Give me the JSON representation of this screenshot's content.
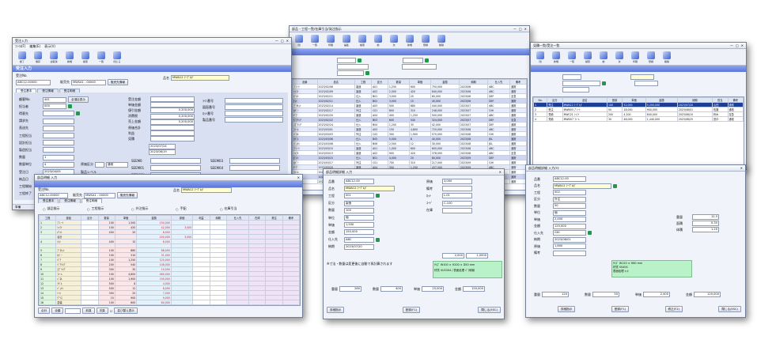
{
  "colors": {
    "header_band": "#6b85e0",
    "purple_table": "#6c6fc7",
    "selected_row": "#1d3f93",
    "input_yellow": "#ffffd2",
    "green_icon": "#1f9a4a"
  },
  "win1": {
    "title": "受注入力",
    "menu": [
      "ﾌｧｲﾙ(F)",
      "編集(E)",
      "表示(V)"
    ],
    "toolbar": [
      "終了",
      "保存",
      "全取消",
      "新規",
      "検索",
      "一覧",
      "閉じる"
    ],
    "band": "受注入力",
    "order_no_label": "受注No.",
    "order_no_value": "ABC12-00000",
    "dept_label": "販売先",
    "dept_value": "MWSA1 - 00000",
    "dept_btn": "販売先情報",
    "customer_label": "品名",
    "customer_value": "MWA12 ﾏｰｸﾞﾙｶﾞ",
    "tabs": [
      "受注基本",
      "受注情報",
      "受注明細"
    ],
    "left_labels": [
      "顧客No.",
      "担当者",
      "得意先",
      "請求先",
      "直送先",
      "工程担当",
      "設計担当",
      "製造担当",
      "数量",
      "数量単位",
      "受注日",
      "納品日",
      "工程開始",
      "工程終了"
    ],
    "left_values": [
      "441",
      "000",
      "",
      "",
      "",
      "",
      "",
      "",
      "1",
      "4",
      "2023/04/05",
      "2023/07/20",
      "2023/05/01",
      "2023/06/07"
    ],
    "left_extra": "全項目表示",
    "sub_selects": [
      "原価区分",
      "製品レベル",
      "通常"
    ],
    "mid_labels": [
      "受注金額",
      "単価金額",
      "値引金額",
      "消費税",
      "売上金額",
      "原価合計",
      "利益",
      "見積"
    ],
    "mid_values": [
      "",
      "",
      "5,200,000",
      "5,200,000",
      "5,200,000",
      "",
      "",
      ""
    ],
    "dates": [
      "2023/07/24",
      "2023/06/19"
    ],
    "codes": [
      "SEEM0",
      "SEEM01",
      "SEEM02",
      "SEEM03",
      "SEEM04"
    ],
    "right_labels": [
      "ﾗｲﾝ番号",
      "図面番号",
      "ﾛｯﾄ番号",
      "製品番号"
    ],
    "status": "準備"
  },
  "win2": {
    "title": "部品・工程一覧/在庫引当/発注指示",
    "toolbar": [
      "閉",
      "一覧",
      "印刷",
      "編集",
      "検索",
      "前",
      "次",
      "新規",
      "登録",
      "削除"
    ],
    "headers": [
      "品番",
      "品名",
      "工程",
      "区分",
      "数量",
      "単価",
      "金額",
      "納期",
      "仕入先",
      "備考"
    ],
    "rows": [
      [
        "ﾌﾟﾚｰﾄ",
        "2023/02/06",
        "製造",
        "A01",
        "1,250",
        "600",
        "750,000",
        "2023/06",
        "ABC",
        "通常"
      ],
      [
        "ｼｬﾌﾄ",
        "2023/02/09",
        "製造",
        "A02",
        "2,000",
        "420",
        "840,000",
        "2023/06",
        "ABC",
        "通常"
      ],
      [
        "ﾎﾞﾙﾄ",
        "2023/02/11",
        "仕入",
        "B01",
        "3,000",
        "20",
        "60,000",
        "2023/06",
        "DEF",
        "至急"
      ],
      [
        "ﾅｯﾄ",
        "2023/02/11",
        "仕入",
        "B02",
        "3,000",
        "15",
        "45,000",
        "2023/06",
        "DEF",
        "通常"
      ],
      [
        "ﾌﾞﾗｹｯﾄ",
        "2023/02/14",
        "製造",
        "A03",
        "500",
        "880",
        "440,000",
        "2023/07",
        "ABC",
        "通常"
      ],
      [
        "ｶﾊﾞｰ",
        "2023/02/17",
        "外注",
        "C01",
        "800",
        "310",
        "248,000",
        "2023/07",
        "GHI",
        "通常"
      ],
      [
        "ｷﾞｱ",
        "2023/02/20",
        "製造",
        "A04",
        "400",
        "1,250",
        "500,000",
        "2023/07",
        "ABC",
        "通常"
      ],
      [
        "ﾍﾞｱﾘﾝｸﾞ",
        "2023/02/22",
        "仕入",
        "B03",
        "600",
        "540",
        "324,000",
        "2023/07",
        "DEF",
        "至急"
      ],
      [
        "ｽﾌﾟﾘﾝｸﾞ",
        "2023/02/24",
        "仕入",
        "B04",
        "1,200",
        "35",
        "42,000",
        "2023/07",
        "DEF",
        "通常"
      ],
      [
        "ﾌﾚｰﾑ",
        "2023/03/01",
        "製造",
        "A05",
        "150",
        "4,800",
        "720,000",
        "2023/08",
        "ABC",
        "通常"
      ],
      [
        "ﾊﾟﾈﾙ",
        "2023/03/03",
        "外注",
        "C02",
        "300",
        "1,900",
        "570,000",
        "2023/08",
        "GHI",
        "通常"
      ],
      [
        "ﾗﾍﾞﾙ",
        "2023/03/06",
        "仕入",
        "B05",
        "5,000",
        "8",
        "40,000",
        "2023/08",
        "JKL",
        "通常"
      ],
      [
        "ﾊﾟｯｷﾝ",
        "2023/03/08",
        "仕入",
        "B06",
        "2,500",
        "12",
        "30,000",
        "2023/08",
        "JKL",
        "通常"
      ],
      [
        "ﾌﾟﾚｰﾄ",
        "2023/03/10",
        "製造",
        "A01",
        "1,000",
        "600",
        "600,000",
        "2023/08",
        "ABC",
        "通常"
      ],
      [
        "ｼｬﾌﾄ",
        "2023/03/13",
        "製造",
        "A02",
        "900",
        "420",
        "378,000",
        "2023/08",
        "ABC",
        "至急"
      ],
      [
        "ﾎﾞﾙﾄ",
        "2023/03/15",
        "仕入",
        "B01",
        "4,000",
        "20",
        "80,000",
        "2023/09",
        "DEF",
        "通常"
      ],
      [
        "ｶﾊﾞｰ",
        "2023/03/17",
        "外注",
        "C01",
        "700",
        "310",
        "217,000",
        "2023/09",
        "GHI",
        "通常"
      ],
      [
        "ｷﾞｱ",
        "2023/03/20",
        "製造",
        "A04",
        "350",
        "1,250",
        "437,500",
        "2023/09",
        "ABC",
        "通常"
      ],
      [
        "ﾌﾚｰﾑ",
        "2023/03/22",
        "製造",
        "A05",
        "120",
        "4,800",
        "576,000",
        "2023/09",
        "ABC",
        "通常"
      ],
      [
        "ﾊﾟﾈﾙ",
        "2023/03/24",
        "外注",
        "C02",
        "250",
        "1,900",
        "475,000",
        "2023/09",
        "GHI",
        "通常"
      ],
      [
        "ﾗﾍﾞﾙ",
        "2023/03/27",
        "仕入",
        "B05",
        "3,000",
        "8",
        "24,000",
        "2023/09",
        "JKL",
        "通常"
      ]
    ]
  },
  "win3": {
    "title": "見積一覧/受注一覧",
    "toolbar": [
      "閉",
      "新規",
      "一覧",
      "検索",
      "前",
      "次",
      "印刷",
      "登録",
      "削除"
    ],
    "band": "",
    "headers": [
      "No.",
      "区分",
      "品名",
      "数量",
      "単価",
      "金額",
      "納期",
      "担当",
      "備考"
    ],
    "rows": [
      [
        "1",
        "受注",
        "MWA12 ﾏｰｸﾞﾙｶﾞ",
        "100",
        "52,000",
        "5,200,000",
        "2023/07/20",
        "山田",
        "通常"
      ],
      [
        "2",
        "受注",
        "MWB03 ﾌﾟﾚｰﾄ",
        "50",
        "18,000",
        "900,000",
        "2023/08/01",
        "佐藤",
        "通常"
      ],
      [
        "3",
        "見積",
        "MWC21 ｼｬﾌﾄ",
        "200",
        "4,200",
        "840,000",
        "2023/08/10",
        "鈴木",
        "至急"
      ],
      [
        "4",
        "見積",
        "MWD07 ﾌﾚｰﾑ",
        "30",
        "48,000",
        "1,440,000",
        "2023/08/25",
        "田中",
        "通常"
      ]
    ]
  },
  "win4": {
    "title": "部品明細 入力",
    "order_no_label": "受注No.",
    "order_no_value": "ABC12-00000",
    "dept_label": "販売先",
    "dept_value": "MWSA1 - 00000",
    "dept_btn": "販売先情報",
    "customer_label": "品名",
    "customer_value": "MWA12 ﾏｰｸﾞﾙｶﾞ",
    "tabs": [
      "受注基本",
      "受注情報",
      "受注明細"
    ],
    "radio_labels": [
      "部品指示",
      "工程指示",
      "外注指示",
      "手配",
      "在庫引当"
    ],
    "headers": [
      "工程",
      "部品",
      "区分",
      "数量",
      "単価",
      "金額",
      "原価",
      "利益",
      "納期",
      "仕入先",
      "在庫",
      "発注",
      "備考"
    ],
    "rows": [
      [
        "1",
        "ﾌﾟﾚｰﾄ",
        "",
        "100",
        "1,500",
        "150,000",
        "",
        "",
        "",
        "",
        "",
        "",
        ""
      ],
      [
        "2",
        "ｼｬﾌﾄ",
        "",
        "100",
        "420",
        "42,000",
        "3,000",
        "",
        "",
        "",
        "",
        "",
        ""
      ],
      [
        "3",
        "ﾎﾞﾙﾄ",
        "",
        "400",
        "20",
        "8,000",
        "",
        "",
        "",
        "",
        "",
        "",
        ""
      ],
      [
        "",
        "合計",
        "",
        "",
        "",
        "200,000",
        "3,000",
        "",
        "",
        "",
        "",
        "",
        ""
      ],
      [
        "4",
        "ﾅｯﾄ",
        "",
        "400",
        "15",
        "6,000",
        "",
        "",
        "",
        "",
        "",
        "",
        ""
      ],
      [
        "",
        "",
        "",
        "",
        "",
        "",
        "",
        "",
        "",
        "",
        "",
        "",
        ""
      ],
      [
        "5",
        "ﾌﾞﾗｹｯﾄ",
        "",
        "100",
        "880",
        "88,000",
        "",
        "",
        "",
        "",
        "",
        "",
        ""
      ],
      [
        "6",
        "ｶﾊﾞｰ",
        "",
        "100",
        "310",
        "31,000",
        "",
        "",
        "",
        "",
        "",
        "",
        ""
      ],
      [
        "7",
        "ｷﾞｱ",
        "",
        "100",
        "1,250",
        "125,000",
        "",
        "",
        "",
        "",
        "",
        "",
        ""
      ],
      [
        "8",
        "ﾍﾞｱﾘﾝｸﾞ",
        "",
        "200",
        "540",
        "108,000",
        "",
        "",
        "",
        "",
        "",
        "",
        ""
      ],
      [
        "9",
        "ｽﾌﾟﾘﾝｸﾞ",
        "",
        "300",
        "35",
        "10,500",
        "",
        "",
        "",
        "",
        "",
        "",
        ""
      ],
      [
        "10",
        "ﾌﾚｰﾑ",
        "",
        "100",
        "4,800",
        "480,000",
        "",
        "",
        "",
        "",
        "",
        "",
        ""
      ],
      [
        "11",
        "ﾊﾟﾈﾙ",
        "",
        "100",
        "1,900",
        "190,000",
        "",
        "",
        "",
        "",
        "",
        "",
        ""
      ],
      [
        "12",
        "ﾗﾍﾞﾙ",
        "",
        "500",
        "8",
        "4,000",
        "",
        "",
        "",
        "",
        "",
        "",
        ""
      ],
      [
        "13",
        "ﾊﾟｯｷﾝ",
        "",
        "500",
        "12",
        "6,000",
        "",
        "",
        "",
        "",
        "",
        "",
        ""
      ],
      [
        "14",
        "ｼｰﾙ",
        "",
        "300",
        "25",
        "7,500",
        "",
        "",
        "",
        "",
        "",
        "",
        ""
      ],
      [
        "15",
        "ｸﾞﾘｽ",
        "",
        "10",
        "900",
        "9,000",
        "",
        "",
        "",
        "",
        "",
        "",
        ""
      ],
      [
        "16",
        "塗装",
        "",
        "100",
        "600",
        "60,000",
        "",
        "",
        "",
        "",
        "",
        "",
        ""
      ],
      [
        "17",
        "検査",
        "",
        "100",
        "300",
        "30,000",
        "",
        "",
        "",
        "",
        "",
        "",
        ""
      ],
      [
        "18",
        "梱包",
        "",
        "100",
        "150",
        "15,000",
        "",
        "",
        "",
        "",
        "",
        "",
        ""
      ]
    ],
    "summary_rows": [
      [
        "合計",
        "",
        "",
        "",
        "",
        "1,370,000",
        "3,000",
        "",
        "",
        "",
        "",
        "",
        ""
      ],
      [
        "",
        "",
        "",
        "",
        "",
        "",
        "",
        "",
        "",
        "",
        "",
        "",
        ""
      ],
      [
        "",
        "",
        "",
        "",
        "",
        "",
        "",
        "",
        "",
        "",
        "",
        "",
        ""
      ],
      [
        "",
        "",
        "",
        "",
        "",
        "",
        "",
        "",
        "",
        "",
        "",
        "",
        ""
      ],
      [
        "",
        "",
        "",
        "",
        "",
        "",
        "",
        "",
        "",
        "",
        "",
        "",
        ""
      ],
      [
        "",
        "",
        "",
        "",
        "",
        "",
        "",
        "",
        "",
        "",
        "",
        "",
        ""
      ]
    ],
    "footer": [
      "合計",
      "全額",
      "前頁",
      "次頁"
    ],
    "footer_check": "並び替え表示"
  },
  "win5": {
    "title": "部品明細詳細 入力",
    "labels": [
      "品番",
      "品名",
      "工程",
      "区分",
      "数量",
      "単位",
      "単価",
      "金額",
      "仕入先",
      "納期",
      "原価",
      "備考",
      "ﾛｯﾄ",
      "ｺｰﾄﾞ",
      "在庫"
    ],
    "values": [
      "ABC12-00",
      "MWA12 ﾏｰｸﾞﾙｶﾞ",
      "001",
      "製造",
      "100",
      "個",
      "1,500",
      "150,000",
      "ABC",
      "2023/07/20",
      "3,000",
      "",
      "L-01",
      "C-100",
      ""
    ],
    "note": "※寸法・数量は変更後に自動で再計算されます",
    "memo_lines": [
      "ｻｲｽﾞ W100 × H200 × D50 mm",
      "材質 SUS304 / 表面処理 ﾊﾞﾌ研磨"
    ],
    "totals": [
      "2,000",
      "1,0000"
    ],
    "bottom_labels": [
      "重量",
      "数量",
      "単価",
      "金額"
    ],
    "bottom_values": [
      "280",
      "400",
      "25,000",
      "150,000"
    ],
    "btns": [
      "詳細指示",
      "登録(F1)",
      "閉じる(ESC)"
    ]
  },
  "win6": {
    "title": "部品明細詳細 入力/ﾒﾓ",
    "labels": [
      "品番",
      "品名",
      "工程",
      "区分",
      "数量",
      "単位",
      "単価",
      "金額",
      "仕入先",
      "納期",
      "原価",
      "備考"
    ],
    "values": [
      "ABC12-00",
      "MWA12 ﾏｰｸﾞﾙｶﾞ",
      "002",
      "外注",
      "50",
      "個",
      "2,400",
      "120,000",
      "GHI",
      "2023/08/01",
      "1,800",
      ""
    ],
    "right_labels": [
      "重量",
      "面積",
      "体積"
    ],
    "right_values": [
      "12.5",
      "0.35",
      "1.20"
    ],
    "memo_lines": [
      "ｻｲｽﾞ W120 × H80 mm",
      "材質 SS400",
      "表面処理 ﾒｯｷ"
    ],
    "bottom_labels": [
      "重量",
      "数量",
      "単価",
      "金額"
    ],
    "bottom_values": [
      "120",
      "50",
      "2,400",
      "120,000"
    ],
    "btns": [
      "詳細指示",
      "登録(F1)",
      "修正(F2)",
      "閉じる(ESC)"
    ]
  }
}
